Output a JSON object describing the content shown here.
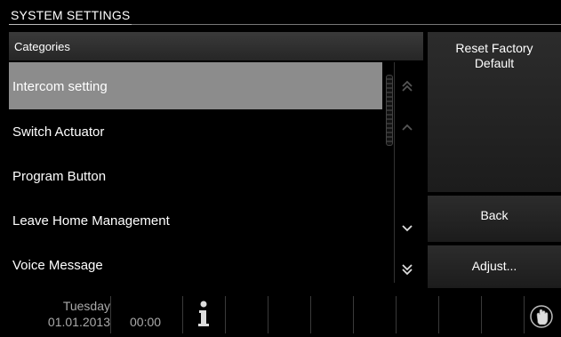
{
  "header": {
    "title": "SYSTEM SETTINGS"
  },
  "categories": {
    "header": "Categories",
    "items": [
      {
        "label": "Intercom setting",
        "selected": true
      },
      {
        "label": "Switch Actuator",
        "selected": false
      },
      {
        "label": "Program Button",
        "selected": false
      },
      {
        "label": "Leave Home Management",
        "selected": false
      },
      {
        "label": "Voice Message",
        "selected": false
      }
    ]
  },
  "scroll": {
    "page_up_icon": "double-chevron-up-icon",
    "line_up_icon": "chevron-up-icon",
    "line_down_icon": "chevron-down-icon",
    "page_down_icon": "double-chevron-down-icon"
  },
  "actions": {
    "reset_label": "Reset Factory Default",
    "back_label": "Back",
    "adjust_label": "Adjust..."
  },
  "status_bar": {
    "day": "Tuesday",
    "date": "01.01.2013",
    "time": "00:00",
    "info_icon": "info-icon",
    "hand_icon": "hand-icon"
  },
  "colors": {
    "background": "#000000",
    "selected_row": "#8c8c8c",
    "text": "#ffffff",
    "status_text": "#aaaaaa"
  }
}
